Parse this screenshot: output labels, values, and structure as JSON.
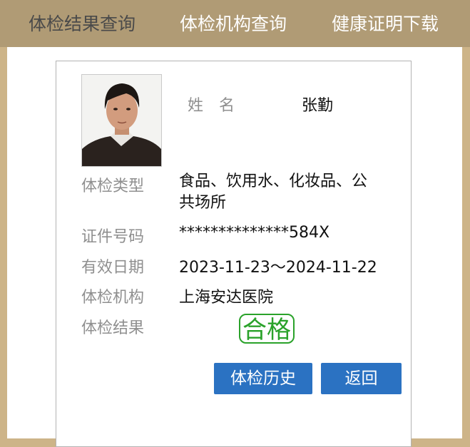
{
  "nav": {
    "tabs": [
      {
        "label": "体检结果查询"
      },
      {
        "label": "体检机构查询"
      },
      {
        "label": "健康证明下载"
      }
    ]
  },
  "person": {
    "name_label": "姓　名",
    "name": "张勤"
  },
  "fields": [
    {
      "label": "体检类型",
      "value": "食品、饮用水、化妆品、公共场所"
    },
    {
      "label": "证件号码",
      "value": "**************584X"
    },
    {
      "label": "有效日期",
      "value": "2023-11-23～2024-11-22"
    },
    {
      "label": "体检机构",
      "value": "上海安达医院"
    },
    {
      "label": "体检结果",
      "value": "合格"
    }
  ],
  "buttons": {
    "history": "体检历史",
    "back": "返回"
  },
  "colors": {
    "nav_bg": "#b09b75",
    "page_bg": "#cdb488",
    "result_stamp": "#2aa22a",
    "button": "#2b72c2"
  }
}
